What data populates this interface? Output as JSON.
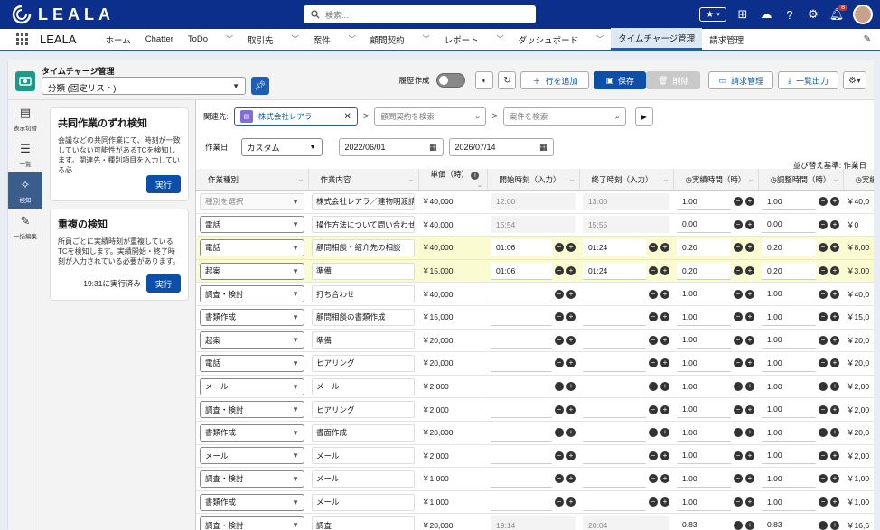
{
  "app": {
    "logo": "LEALA",
    "name": "LEALA",
    "search_placeholder": "検索..."
  },
  "nav": {
    "items": [
      {
        "label": "ホーム",
        "chev": false
      },
      {
        "label": "Chatter",
        "chev": false
      },
      {
        "label": "ToDo",
        "chev": true
      },
      {
        "label": "取引先",
        "chev": true
      },
      {
        "label": "案件",
        "chev": true
      },
      {
        "label": "顧問契約",
        "chev": true
      },
      {
        "label": "レポート",
        "chev": true
      },
      {
        "label": "ダッシュボード",
        "chev": true
      },
      {
        "label": "タイムチャージ管理",
        "chev": false,
        "active": true
      },
      {
        "label": "請求管理",
        "chev": false
      }
    ],
    "notification_count": "8"
  },
  "header": {
    "title": "タイムチャージ管理",
    "view_select": "分類 (固定リスト)",
    "history_label": "履歴作成",
    "add_row": "行を追加",
    "save": "保存",
    "delete": "削除",
    "billing": "請求管理",
    "export": "一覧出力"
  },
  "leftnav": [
    {
      "label": "表示切替",
      "icon": "display-toggle-icon"
    },
    {
      "label": "一覧",
      "icon": "list-icon"
    },
    {
      "label": "検知",
      "icon": "magic-wand-icon",
      "active": true
    },
    {
      "label": "一括編集",
      "icon": "bulk-edit-icon"
    }
  ],
  "panel": {
    "card1": {
      "title": "共同作業のずれ検知",
      "desc": "会議などの共同作業にて、時刻が一致していない可能性があるTCを検知します。関連先・種別項目を入力している必…",
      "run": "実行"
    },
    "card2": {
      "title": "重複の検知",
      "desc": "所員ごとに実績時刻が重複しているTCを検知します。実績開始・終了時刻が入力されている必要があります。",
      "last_run": "19:31に実行済み",
      "run": "実行"
    }
  },
  "filters": {
    "related_label": "関連先:",
    "related_value": "株式会社レアラ",
    "contract_placeholder": "顧問契約を検索",
    "case_placeholder": "案件を検索",
    "date_label": "作業日",
    "date_mode": "カスタム",
    "date_from": "2022/06/01",
    "date_to": "2026/07/14",
    "sort_label": "並び替え基準: 作業日"
  },
  "table": {
    "columns": [
      "作業種別",
      "作業内容",
      "単価（時）",
      "開始時刻（入力）",
      "終了時刻（入力）",
      "実績時間（時）",
      "調整時間（時）",
      "実績"
    ],
    "rows": [
      {
        "type": "種別を選択",
        "content": "株式会社レアラ／建物明渡請求",
        "rate": "￥40,000",
        "start": "12:00",
        "end": "13:00",
        "actual": "1.00",
        "adjust": "1.00",
        "amount": "￥40,0",
        "ro": true
      },
      {
        "type": "電話",
        "content": "操作方法について問い合わせ",
        "rate": "￥40,000",
        "start": "15:54",
        "end": "15:55",
        "actual": "0.00",
        "adjust": "0.00",
        "amount": "￥0",
        "ro": true
      },
      {
        "type": "電話",
        "content": "顧問相談・紹介先の相談",
        "rate": "￥40,000",
        "start": "01:06",
        "end": "01:24",
        "actual": "0.20",
        "adjust": "0.20",
        "amount": "￥8,00",
        "hl": true
      },
      {
        "type": "起案",
        "content": "準備",
        "rate": "￥15,000",
        "start": "01:06",
        "end": "01:24",
        "actual": "0.20",
        "adjust": "0.20",
        "amount": "￥3,00",
        "hl": true
      },
      {
        "type": "調査・検討",
        "content": "打ち合わせ",
        "rate": "￥40,000",
        "start": "",
        "end": "",
        "actual": "1.00",
        "adjust": "1.00",
        "amount": "￥40,0"
      },
      {
        "type": "書類作成",
        "content": "顧問相談の書類作成",
        "rate": "￥15,000",
        "start": "",
        "end": "",
        "actual": "1.00",
        "adjust": "1.00",
        "amount": "￥15,0"
      },
      {
        "type": "起案",
        "content": "準備",
        "rate": "￥20,000",
        "start": "",
        "end": "",
        "actual": "1.00",
        "adjust": "1.00",
        "amount": "￥20,0"
      },
      {
        "type": "電話",
        "content": "ヒアリング",
        "rate": "￥20,000",
        "start": "",
        "end": "",
        "actual": "1.00",
        "adjust": "1.00",
        "amount": "￥20,0"
      },
      {
        "type": "メール",
        "content": "メール",
        "rate": "￥2,000",
        "start": "",
        "end": "",
        "actual": "1.00",
        "adjust": "1.00",
        "amount": "￥2,00"
      },
      {
        "type": "調査・検討",
        "content": "ヒアリング",
        "rate": "￥2,000",
        "start": "",
        "end": "",
        "actual": "1.00",
        "adjust": "1.00",
        "amount": "￥2,00"
      },
      {
        "type": "書類作成",
        "content": "書面作成",
        "rate": "￥20,000",
        "start": "",
        "end": "",
        "actual": "1.00",
        "adjust": "1.00",
        "amount": "￥20,0"
      },
      {
        "type": "メール",
        "content": "メール",
        "rate": "￥2,000",
        "start": "",
        "end": "",
        "actual": "1.00",
        "adjust": "1.00",
        "amount": "￥2,00"
      },
      {
        "type": "調査・検討",
        "content": "メール",
        "rate": "￥1,000",
        "start": "",
        "end": "",
        "actual": "1.00",
        "adjust": "1.00",
        "amount": "￥1,00"
      },
      {
        "type": "書類作成",
        "content": "メール",
        "rate": "￥1,000",
        "start": "",
        "end": "",
        "actual": "1.00",
        "adjust": "1.00",
        "amount": "￥1,00"
      },
      {
        "type": "調査・検討",
        "content": "調査",
        "rate": "￥20,000",
        "start": "19:14",
        "end": "20:04",
        "actual": "0.83",
        "adjust": "0.83",
        "amount": "￥16,6",
        "ro": true
      }
    ]
  },
  "colors": {
    "brand": "#0b2f8a",
    "accent": "#0b4fa8",
    "highlight": "#fbfbd2"
  }
}
